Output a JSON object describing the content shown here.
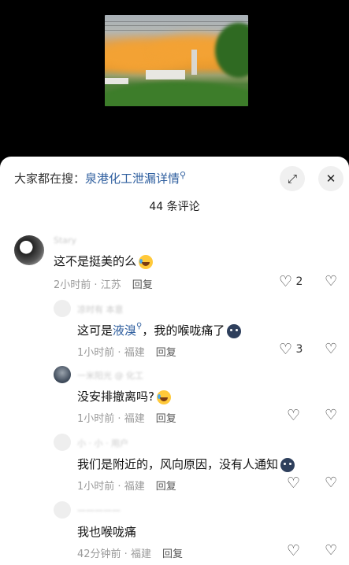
{
  "search": {
    "prefix": "大家都在搜：",
    "keyword": "泉港化工泄漏详情",
    "keyword_icon": "search-icon"
  },
  "controls": {
    "expand_icon": "expand-icon",
    "close_icon": "close-icon"
  },
  "comments_count": "44 条评论",
  "comments": [
    {
      "username": "Stary",
      "text": "这不是挺美的么",
      "emoji": "laugh-cry-emoji",
      "time": "2小时前",
      "location": "江苏",
      "reply": "回复",
      "likes": "2"
    },
    {
      "username": "凉时有 本意",
      "text_before": "这可是",
      "link": "液溴",
      "text_after": "，我的喉咙痛了",
      "emoji": "sad-face-emoji",
      "time": "1小时前",
      "location": "福建",
      "reply": "回复",
      "likes": "3"
    },
    {
      "username": "一米阳光 @ 化工",
      "text": "没安排撤离吗?",
      "emoji": "laugh-cry-emoji",
      "time": "1小时前",
      "location": "福建",
      "reply": "回复",
      "likes": ""
    },
    {
      "username": "小 · 小 · 用户",
      "text": "我们是附近的，风向原因，没有人通知",
      "emoji": "sad-face-emoji",
      "time": "1小时前",
      "location": "福建",
      "reply": "回复",
      "likes": ""
    },
    {
      "username": "一一一一一",
      "text": "我也喉咙痛",
      "time": "42分钟前",
      "location": "福建",
      "reply": "回复",
      "likes": ""
    }
  ]
}
